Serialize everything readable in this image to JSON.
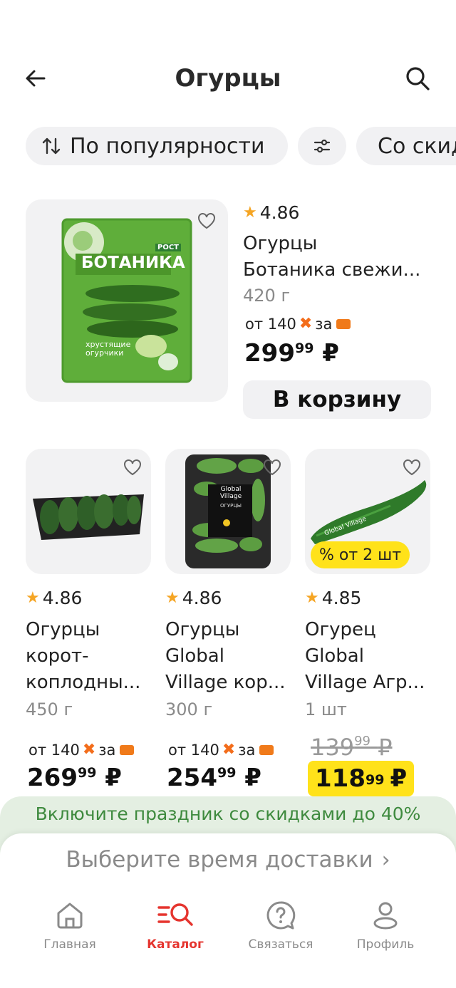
{
  "header": {
    "title": "Огурцы"
  },
  "filters": {
    "sort_label": "По популярности",
    "discount_chip": "Со скид"
  },
  "featured": {
    "rating": "4.86",
    "name": "Огурцы Ботаника свежи...",
    "name_line1": "Огурцы",
    "name_line2": "Ботаника свежи...",
    "weight": "420 г",
    "promo_text": "от 140",
    "promo_suffix": "за",
    "price_int": "299",
    "price_frac": "99",
    "currency": "₽",
    "cart_label": "В корзину",
    "package_brand": "БОТАНИКА",
    "package_label": "РОСТ",
    "package_text": "хрустящие огурчики"
  },
  "products": [
    {
      "rating": "4.86",
      "name_line1": "Огурцы",
      "name_line2": "корот-",
      "name_line3": "коплодны...",
      "weight": "450 г",
      "promo_text": "от 140",
      "promo_suffix": "за",
      "price_int": "269",
      "price_frac": "99",
      "currency": "₽"
    },
    {
      "rating": "4.86",
      "name_line1": "Огурцы",
      "name_line2": "Global",
      "name_line3": "Village кор...",
      "weight": "300 г",
      "promo_text": "от 140",
      "promo_suffix": "за",
      "price_int": "254",
      "price_frac": "99",
      "currency": "₽",
      "package_brand": "Global Village",
      "package_text": "ОГУРЦЫ"
    },
    {
      "rating": "4.85",
      "name_line1": "Огурец",
      "name_line2": "Global",
      "name_line3": "Village Агр...",
      "weight": "1 шт",
      "badge": "% от 2 шт",
      "old_price_int": "139",
      "old_price_frac": "99",
      "price_int": "118",
      "price_frac": "99",
      "currency": "₽",
      "package_brand": "Global Village"
    }
  ],
  "banner": {
    "text": "Включите праздник со скидками до 40%"
  },
  "delivery": {
    "text": "Выберите время доставки",
    "arrow": "›"
  },
  "tabs": [
    {
      "label": "Главная",
      "icon": "home-icon"
    },
    {
      "label": "Каталог",
      "icon": "catalog-search-icon"
    },
    {
      "label": "Связаться",
      "icon": "help-bubble-icon"
    },
    {
      "label": "Профиль",
      "icon": "profile-icon"
    }
  ],
  "colors": {
    "accent": "#e5342e",
    "sale": "#ffe21a",
    "promo": "#f36d1b",
    "banner_text": "#3e8a3e"
  }
}
